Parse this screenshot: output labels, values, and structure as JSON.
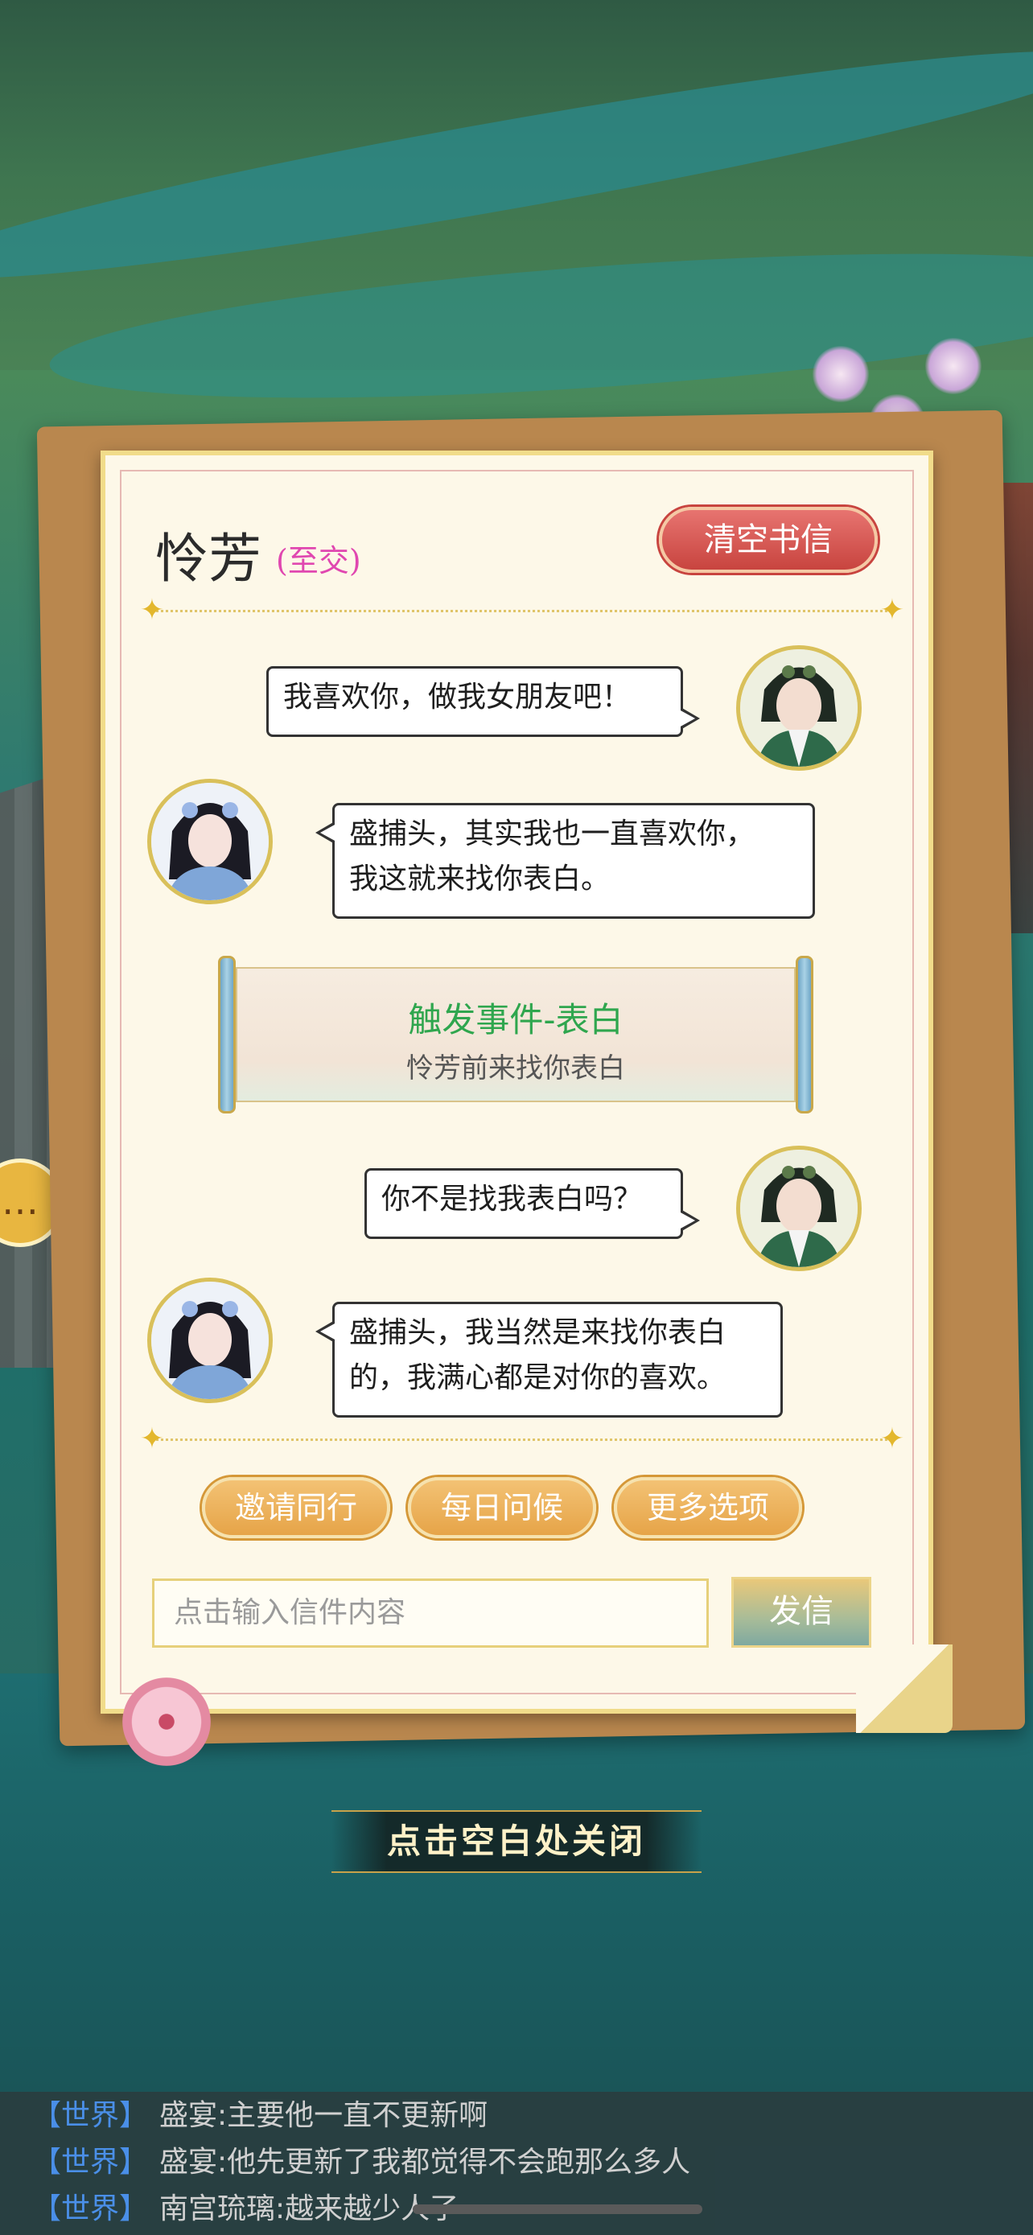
{
  "letter": {
    "contact_name": "怜芳",
    "relationship": "(至交)",
    "clear_button": "清空书信"
  },
  "messages": [
    {
      "sender": "player",
      "text": "我喜欢你，做我女朋友吧！"
    },
    {
      "sender": "contact",
      "lines": [
        "盛捕头，其实我也一直喜欢你，",
        "我这就来找你表白。"
      ]
    },
    {
      "sender": "player",
      "text": "你不是找我表白吗？"
    },
    {
      "sender": "contact",
      "lines": [
        "盛捕头，我当然是来找你表白",
        "的，我满心都是对你的喜欢。"
      ]
    }
  ],
  "event": {
    "title": "触发事件-表白",
    "description": "怜芳前来找你表白"
  },
  "options": [
    "邀请同行",
    "每日问候",
    "更多选项"
  ],
  "input": {
    "placeholder": "点击输入信件内容",
    "send_label": "发信"
  },
  "close_hint": "点击空白处关闭",
  "world_chat": [
    {
      "channel": "【世界】",
      "name": "盛宴:",
      "text": "主要他一直不更新啊"
    },
    {
      "channel": "【世界】",
      "name": "盛宴:",
      "text": "他先更新了我都觉得不会跑那么多人"
    },
    {
      "channel": "【世界】",
      "name": "南宫琉璃:",
      "text": "越来越少人了"
    }
  ],
  "icons": {
    "divider": "sparkle-icon",
    "side_chat": "chat-bubble-icon",
    "decoration": "plum-blossom-icon"
  },
  "colors": {
    "relationship": "#e047b0",
    "event_title": "#2fa64e",
    "world_channel": "#4a8fe8",
    "clear_button": "#c8443f"
  }
}
